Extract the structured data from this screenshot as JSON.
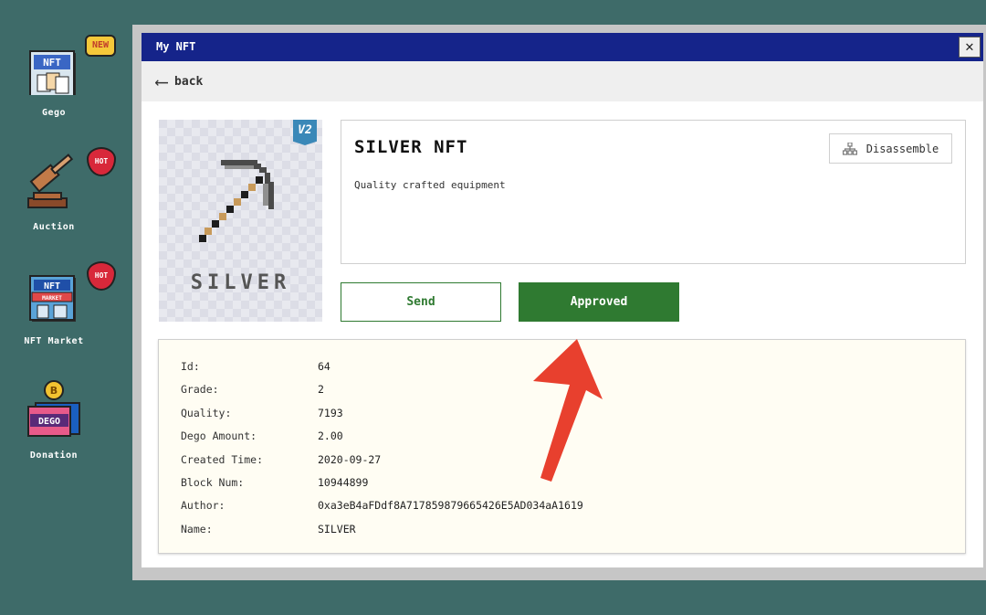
{
  "desktop": {
    "icons": [
      {
        "label": "Gego",
        "badge": "NEW",
        "art_text": "NFT"
      },
      {
        "label": "Auction",
        "badge": "HOT"
      },
      {
        "label": "NFT Market",
        "badge": "HOT",
        "art_text": "NFT",
        "art_subtext": "MARKET"
      },
      {
        "label": "Donation",
        "art_text": "DEGO",
        "coin": "B"
      }
    ]
  },
  "window": {
    "title": "My NFT",
    "close_glyph": "✕",
    "back_label": "back",
    "back_icon": "arrow-left-icon"
  },
  "nft": {
    "image_title": "SILVER",
    "version_badge": "V2",
    "title": "SILVER NFT",
    "description": "Quality crafted equipment",
    "disassemble_label": "Disassemble",
    "send_label": "Send",
    "approved_label": "Approved"
  },
  "details": {
    "rows": [
      {
        "key": "Id:",
        "value": "64"
      },
      {
        "key": "Grade:",
        "value": "2"
      },
      {
        "key": "Quality:",
        "value": "7193"
      },
      {
        "key": "Dego Amount:",
        "value": "2.00"
      },
      {
        "key": "Created Time:",
        "value": "2020-09-27"
      },
      {
        "key": "Block Num:",
        "value": "10944899"
      },
      {
        "key": "Author:",
        "value": "0xa3eB4aFDdf8A717859879665426E5AD034aA1619"
      },
      {
        "key": "Name:",
        "value": "SILVER"
      }
    ]
  },
  "colors": {
    "desktop_bg": "#3e6b69",
    "titlebar": "#15248a",
    "accent_green": "#2f7a31",
    "annotation_arrow": "#e8402e"
  }
}
